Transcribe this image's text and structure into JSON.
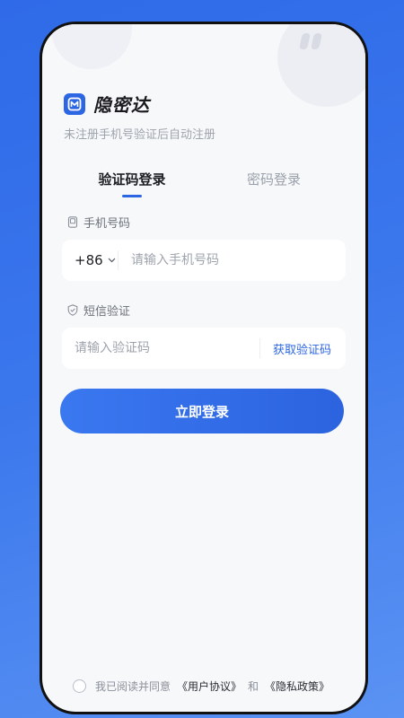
{
  "app": {
    "name": "隐密达",
    "subtitle": "未注册手机号验证后自动注册"
  },
  "tabs": [
    {
      "label": "验证码登录",
      "active": true
    },
    {
      "label": "密码登录",
      "active": false
    }
  ],
  "phone_field": {
    "label": "手机号码",
    "country_code": "+86",
    "placeholder": "请输入手机号码"
  },
  "sms_field": {
    "label": "短信验证",
    "placeholder": "请输入验证码",
    "get_code_label": "获取验证码"
  },
  "login_button": "立即登录",
  "agreement": {
    "prefix": "我已阅读并同意",
    "user_agreement": "《用户协议》",
    "conjunction": "和",
    "privacy_policy": "《隐私政策》"
  },
  "colors": {
    "accent": "#2c66e2",
    "background_gradient": [
      "#2f6ae8",
      "#5a93f3"
    ]
  }
}
